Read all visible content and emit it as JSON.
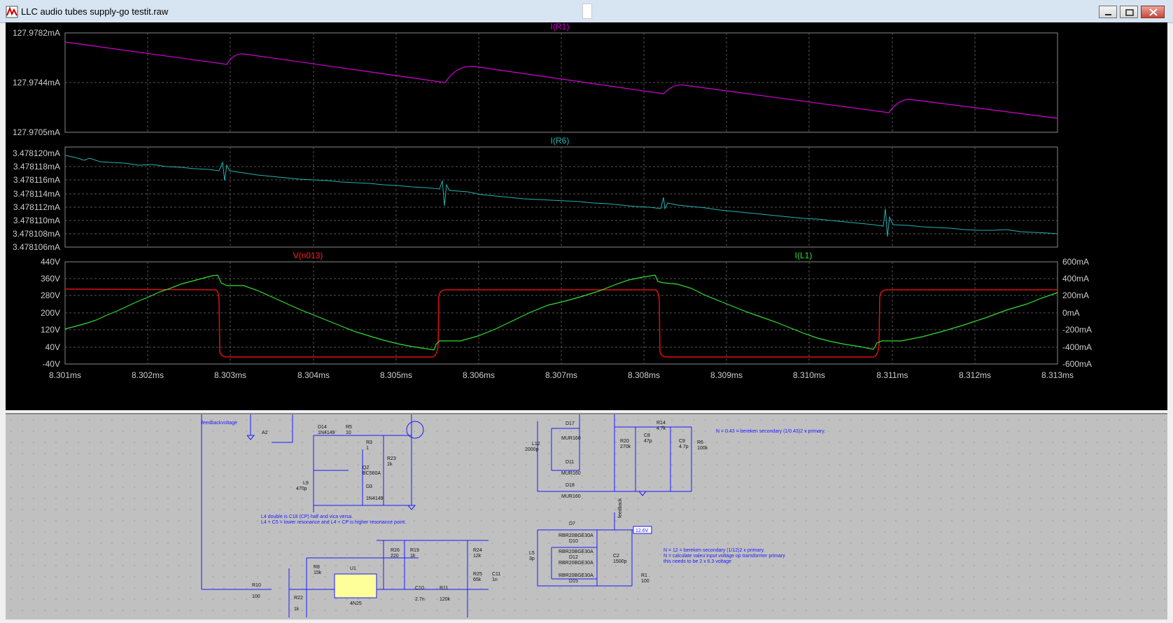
{
  "window": {
    "title": "LLC audio tubes supply-go testit.raw"
  },
  "pane1": {
    "trace": "I(R1)",
    "color": "#d400d4",
    "yticks": [
      "127.9782mA",
      "127.9744mA",
      "127.9705mA"
    ]
  },
  "pane2": {
    "trace": "I(R6)",
    "color": "#24b2b2",
    "yticks": [
      "3.478120mA",
      "3.478118mA",
      "3.478116mA",
      "3.478114mA",
      "3.478112mA",
      "3.478110mA",
      "3.478108mA",
      "3.478106mA"
    ]
  },
  "pane3": {
    "trace_left": "V(n013)",
    "trace_left_color": "#ff2020",
    "trace_right": "I(L1)",
    "trace_right_color": "#33dd33",
    "yticks_left": [
      "440V",
      "360V",
      "280V",
      "200V",
      "120V",
      "40V",
      "-40V"
    ],
    "yticks_right": [
      "600mA",
      "400mA",
      "200mA",
      "0mA",
      "-200mA",
      "-400mA",
      "-600mA"
    ]
  },
  "xaxis": {
    "ticks": [
      "8.301ms",
      "8.302ms",
      "8.303ms",
      "8.304ms",
      "8.305ms",
      "8.306ms",
      "8.307ms",
      "8.308ms",
      "8.309ms",
      "8.310ms",
      "8.311ms",
      "8.312ms",
      "8.313ms"
    ]
  },
  "schematic": {
    "net_label": "feedbackvoltage",
    "component_labels": [
      "A2",
      "D14",
      "1N4149",
      "R5",
      "10",
      "R3",
      "1",
      "R23",
      "1k",
      "Q2",
      "BC560A",
      "D3",
      "1N4149",
      "L9",
      "470p",
      "D17",
      "MUR160",
      "L12",
      "2000p",
      "D11",
      "MUR160",
      "D18",
      "MUR160",
      "R20",
      "270k",
      "C8",
      "47p",
      "R14",
      "4.7k",
      "C9",
      "4.7p",
      "R6",
      "100k",
      "D7",
      "RBR20BGE30A",
      "D10",
      "RBR20BGE30A",
      "D12",
      "RBR20BGE30A",
      "D15",
      "RBR20BGE30A",
      "L5",
      "3p",
      "C2",
      "1500p",
      "R1",
      "100",
      "12.6V",
      "feedback",
      "R26",
      "220",
      "R19",
      "1k",
      "R24",
      "12k",
      "R25",
      "65k",
      "C11",
      "1n",
      "U1",
      "4N25",
      "R8",
      "15k",
      "R10",
      "100",
      "R22",
      "1k",
      "C10",
      "2.7n",
      "R11",
      "120k"
    ],
    "notes": [
      "N = 0.43 = bereken secondary (1/0.43)2 x primary.",
      "L4 double is C18 (CP) half and vica versa.",
      "L4 + C5 = lower resonance and L4 + CP is higher resonance point.",
      "N = 12 = bereken secondary (1/12)2 x primary.",
      "N = calculate valeu input voltage op transformer primary",
      "this needs to be 2 x 6.3 voltage"
    ]
  }
}
